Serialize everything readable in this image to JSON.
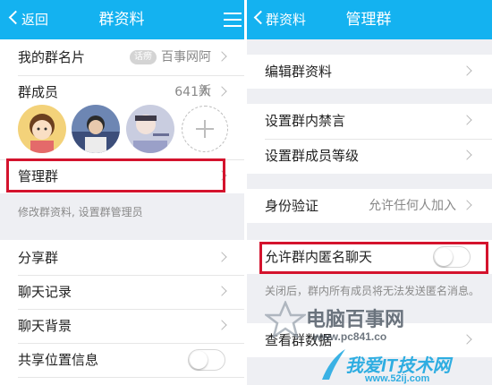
{
  "left": {
    "header": {
      "back_label": "返回",
      "title": "群资料"
    },
    "card_label": {
      "label": "我的群名片",
      "tag": "话痨",
      "value": "百事网阿新"
    },
    "members": {
      "label": "群成员",
      "count": "641人"
    },
    "manage": {
      "label": "管理群",
      "hint": "修改群资料, 设置群管理员"
    },
    "items": [
      {
        "label": "分享群"
      },
      {
        "label": "聊天记录"
      },
      {
        "label": "聊天背景"
      },
      {
        "label": "共享位置信息"
      }
    ]
  },
  "right": {
    "header": {
      "back_label": "群资料",
      "title": "管理群"
    },
    "items": [
      {
        "label": "编辑群资料"
      },
      {
        "label": "设置群内禁言"
      },
      {
        "label": "设置群成员等级"
      }
    ],
    "verify": {
      "label": "身份验证",
      "value": "允许任何人加入"
    },
    "anonymous": {
      "label": "允许群内匿名聊天",
      "hint": "关闭后，群内所有成员将无法发送匿名消息。"
    },
    "stats": {
      "label": "查看群数据"
    }
  },
  "watermark": {
    "site_name": "电脑百事网",
    "site_url": "www.pc841.co",
    "site2_name": "我爱IT技术网",
    "site2_url": "www.52ij.com"
  },
  "colors": {
    "header_bg": "#14b2f0",
    "highlight": "#d4132d"
  }
}
